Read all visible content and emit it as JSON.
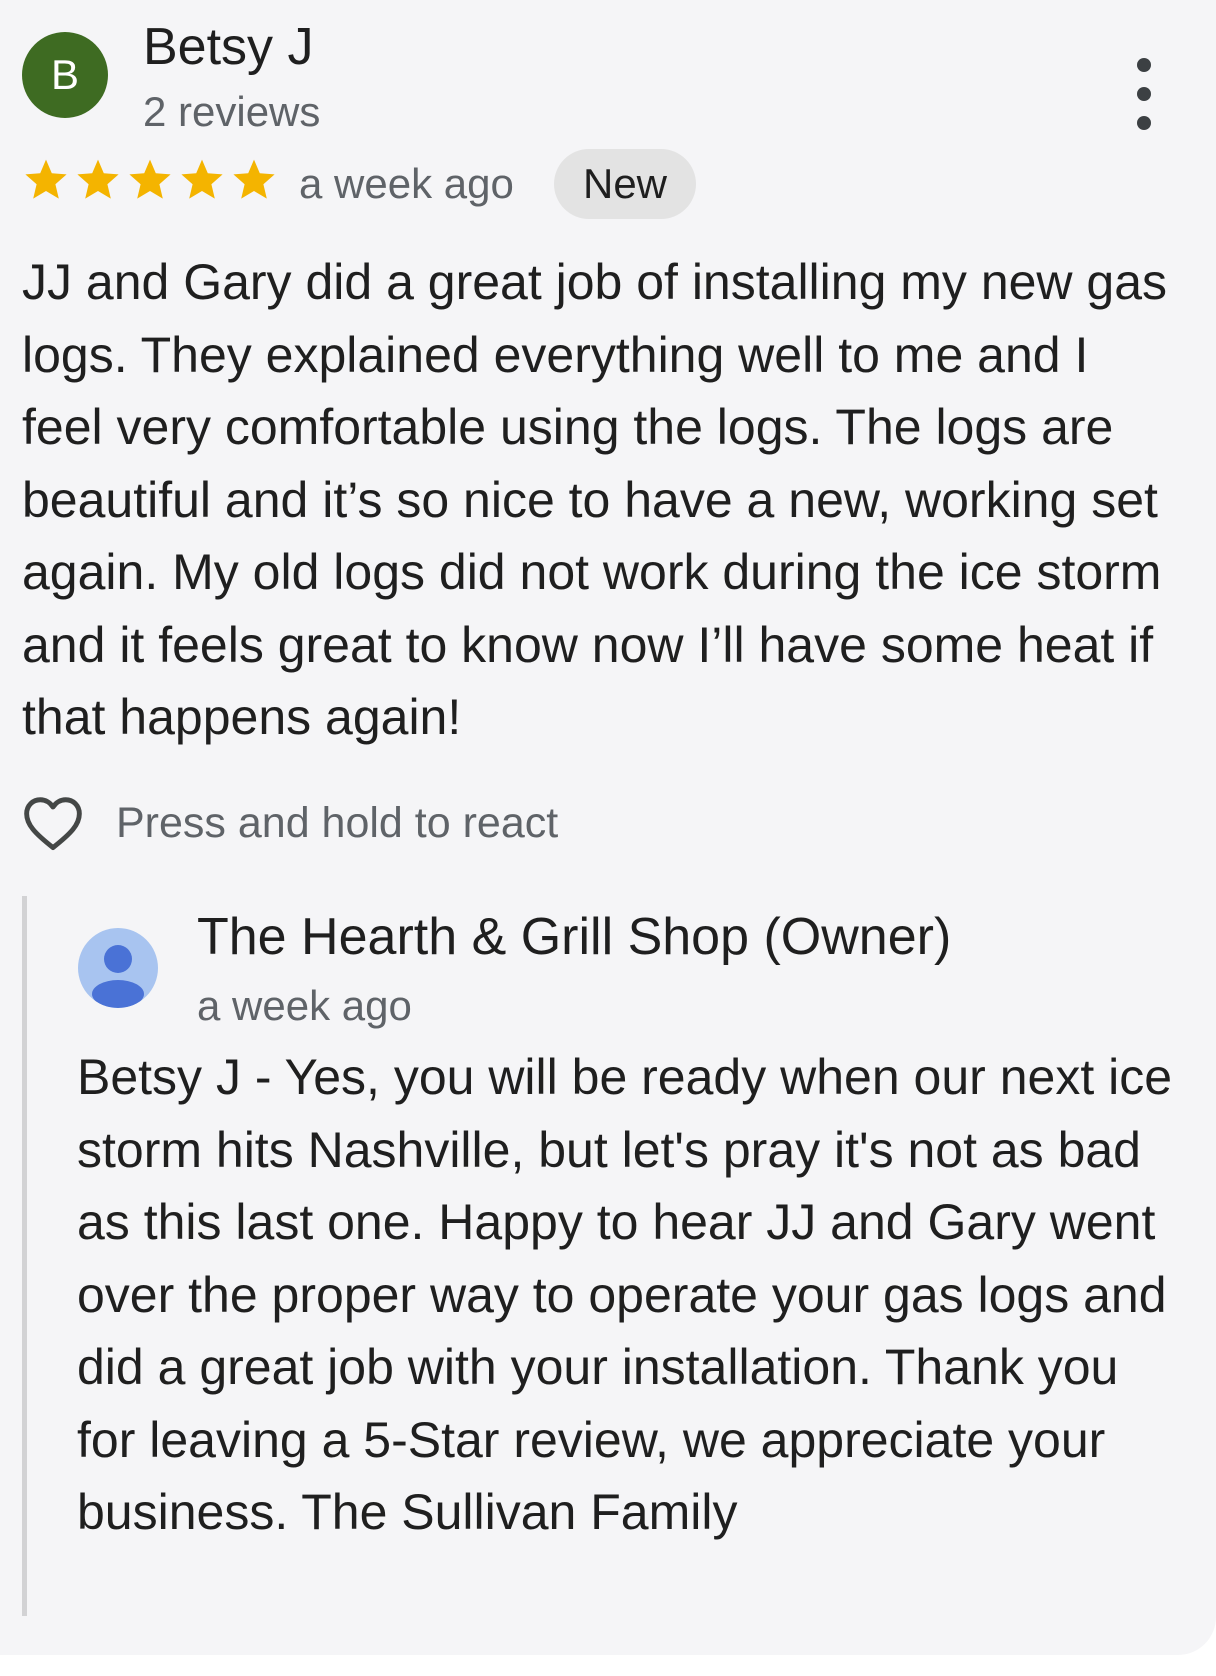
{
  "review": {
    "avatar_letter": "B",
    "avatar_color": "#3e6b22",
    "reviewer_name": "Betsy J",
    "review_count": "2 reviews",
    "rating": 5,
    "max_rating": 5,
    "star_color": "#f4b400",
    "time": "a week ago",
    "badge": "New",
    "text": "JJ and Gary did a great job of installing my new gas logs. They explained everything well to me and I feel very comfortable using the logs. The logs are beautiful and it’s so nice to have a new, working set again. My old logs did not work during the ice storm and it feels great to know now I’ll have some heat if that happens again!",
    "more_icon": "more-vert-icon"
  },
  "reaction": {
    "icon": "heart-outline-icon",
    "label": "Press and hold to react"
  },
  "owner_reply": {
    "avatar_icon": "person-icon",
    "avatar_color": "#a8c4f0",
    "name": "The Hearth & Grill Shop (Owner)",
    "time": "a week ago",
    "text": "Betsy J - Yes, you will be ready when our next ice storm hits Nashville, but let's pray it's not as bad as this last one. Happy to hear JJ and Gary went over the proper way to operate your gas logs and did a great job with your installation. Thank you for leaving a 5-Star review, we appreciate your business. The Sullivan Family"
  }
}
